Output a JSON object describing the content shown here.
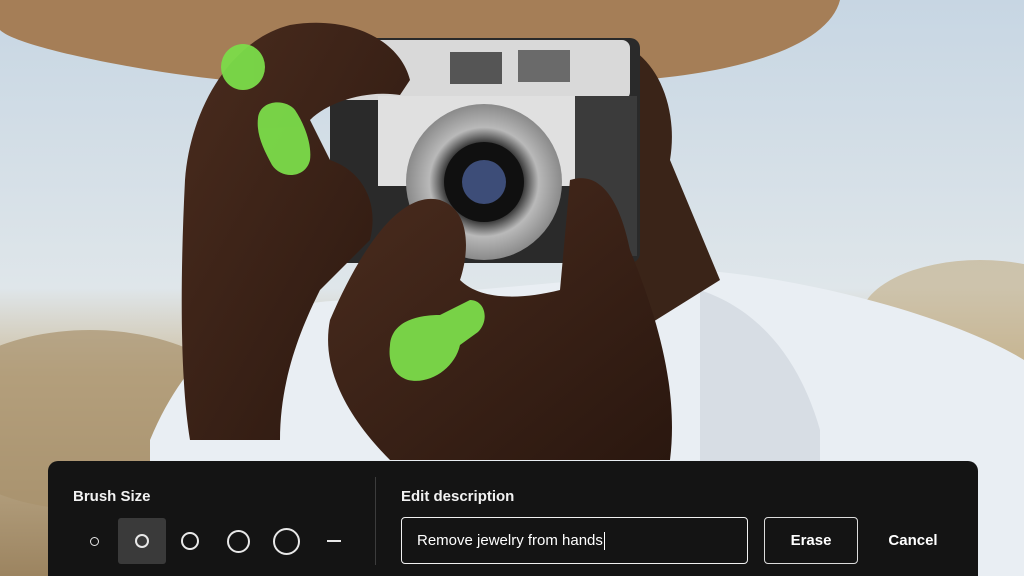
{
  "photo": {
    "subject": "person-with-camera-photo",
    "mask_color": "#7bdc4a"
  },
  "toolbar": {
    "brush_size_label": "Brush Size",
    "brush_options": [
      "extra-small",
      "small",
      "medium",
      "large",
      "extra-large",
      "line"
    ],
    "selected_brush_option": "small",
    "edit_description_label": "Edit description",
    "edit_description_value": "Remove jewelry from hands",
    "erase_label": "Erase",
    "cancel_label": "Cancel"
  },
  "colors": {
    "toolbar_bg": "#141414",
    "text": "#ffffff",
    "selected_brush_bg": "#3a3a3a"
  }
}
